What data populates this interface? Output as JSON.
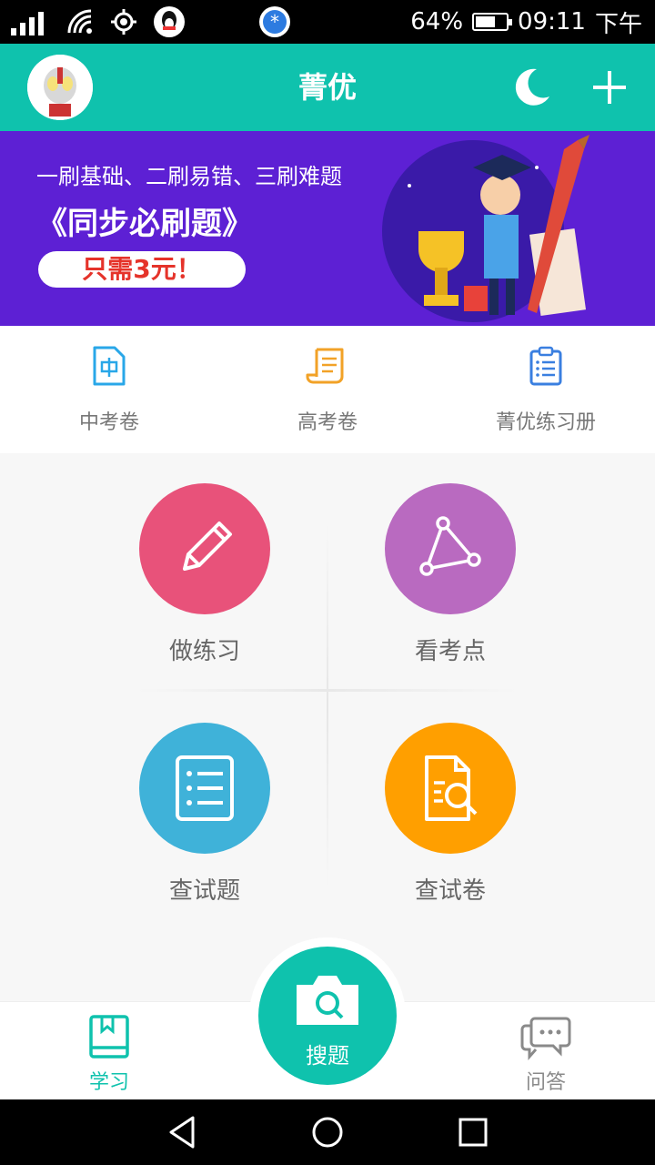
{
  "status_bar": {
    "battery_percent": "64%",
    "time": "09:11",
    "period": "下午",
    "battery_level": 0.64
  },
  "header": {
    "title": "菁优",
    "icons": [
      "avatar",
      "moon-icon",
      "plus-icon"
    ]
  },
  "banner": {
    "line1": "一刷基础、二刷易错、三刷难题",
    "line2": "《同步必刷题》",
    "price_pill": "只需3元！"
  },
  "quick_links": [
    {
      "label": "中考卷",
      "icon": "doc-zhong-icon",
      "color": "#29a7e8"
    },
    {
      "label": "高考卷",
      "icon": "scroll-icon",
      "color": "#f2a227"
    },
    {
      "label": "菁优练习册",
      "icon": "clipboard-icon",
      "color": "#3a7fe0"
    }
  ],
  "features": [
    {
      "label": "做练习",
      "icon": "pencil-icon",
      "color": "#e8527a"
    },
    {
      "label": "看考点",
      "icon": "triangle-icon",
      "color": "#b96ac0"
    },
    {
      "label": "查试题",
      "icon": "list-icon",
      "color": "#3fb2d9"
    },
    {
      "label": "查试卷",
      "icon": "search-doc-icon",
      "color": "#ff9f00"
    }
  ],
  "bottom_nav": {
    "study": "学习",
    "search": "搜题",
    "qa": "问答",
    "active_color": "#0fc2ad",
    "inactive_color": "#8a8a8a"
  }
}
